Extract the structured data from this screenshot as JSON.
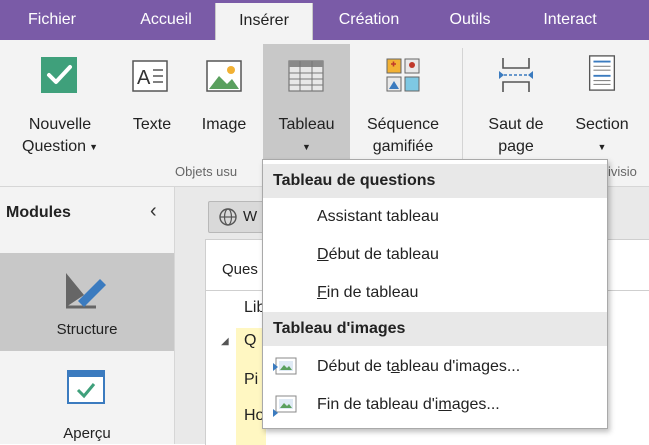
{
  "tabs": [
    {
      "label": "Fichier"
    },
    {
      "label": "Accueil"
    },
    {
      "label": "Insérer"
    },
    {
      "label": "Création"
    },
    {
      "label": "Outils"
    },
    {
      "label": "Interact"
    }
  ],
  "ribbon": {
    "buttons": {
      "nouvelle_question": {
        "line1": "Nouvelle",
        "line2": "Question"
      },
      "texte": {
        "line1": "Texte"
      },
      "image": {
        "line1": "Image"
      },
      "tableau": {
        "line1": "Tableau"
      },
      "sequence": {
        "line1": "Séquence",
        "line2": "gamifiée"
      },
      "saut": {
        "line1": "Saut de",
        "line2": "page"
      },
      "section": {
        "line1": "Section"
      }
    },
    "groups": {
      "objets": "Objets usu",
      "division": "ivisio"
    }
  },
  "modules": {
    "title": "Modules",
    "items": [
      {
        "label": "Structure"
      },
      {
        "label": "Aperçu"
      }
    ]
  },
  "content": {
    "w_button": "W",
    "tab": "Ques",
    "col": "Lib",
    "rows": [
      "Q",
      "Pi",
      "Ho"
    ]
  },
  "dropdown": {
    "header1": "Tableau de questions",
    "items1": [
      {
        "pre": "Assistant tableau",
        "u": "",
        "post": ""
      },
      {
        "pre": "",
        "u": "D",
        "post": "ébut de tableau"
      },
      {
        "pre": "",
        "u": "F",
        "post": "in de tableau"
      }
    ],
    "header2": "Tableau d'images",
    "items2": [
      {
        "pre": "Début de t",
        "u": "a",
        "post": "bleau d'images..."
      },
      {
        "pre": "Fin de tableau d'i",
        "u": "m",
        "post": "ages..."
      }
    ]
  },
  "colors": {
    "accent": "#7a5ba7",
    "ribbon_bg": "#f3f3f3",
    "pressed": "#c8c8c8",
    "check_green": "#3fa07b"
  }
}
